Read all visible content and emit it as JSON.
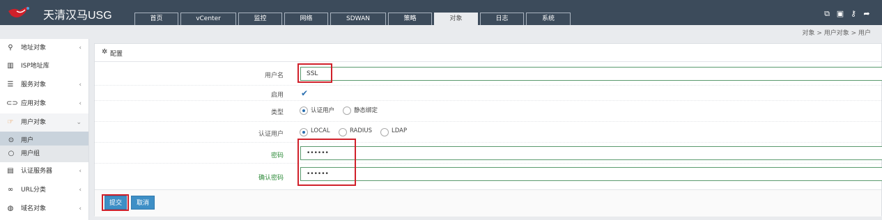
{
  "app": {
    "title": "天清汉马USG",
    "logo_icon": "bird-logo-icon"
  },
  "nav": {
    "tabs": [
      "首页",
      "vCenter",
      "监控",
      "网络",
      "SDWAN",
      "策略",
      "对象",
      "日志",
      "系统"
    ],
    "active": "对象"
  },
  "toolbar": {
    "icons": [
      "compare-icon",
      "save-icon",
      "key-icon",
      "logout-icon"
    ]
  },
  "breadcrumb": {
    "text": "对象 > 用户对象 > 用户"
  },
  "sidebar": {
    "items": [
      {
        "label": "地址对象",
        "icon": "map-marker-icon"
      },
      {
        "label": "ISP地址库",
        "icon": "map-icon"
      },
      {
        "label": "服务对象",
        "icon": "list-icon"
      },
      {
        "label": "应用对象",
        "icon": "toggle-icon"
      },
      {
        "label": "用户对象",
        "icon": "hand-pointer-icon"
      },
      {
        "label": "用户",
        "icon": "radio-dot-icon"
      },
      {
        "label": "用户组",
        "icon": "circle-icon"
      },
      {
        "label": "认证服务器",
        "icon": "server-icon"
      },
      {
        "label": "URL分类",
        "icon": "link-icon"
      },
      {
        "label": "域名对象",
        "icon": "globe-icon"
      }
    ],
    "selected": "用户"
  },
  "panel": {
    "title": "配置",
    "username_label": "用户名",
    "username_value": "SSL",
    "enabled_label": "启用",
    "type_label": "类型",
    "type_options": [
      "认证用户",
      "静态绑定"
    ],
    "type_selected": "认证用户",
    "auth_label": "认证用户",
    "auth_options": [
      "LOCAL",
      "RADIUS",
      "LDAP"
    ],
    "auth_selected": "LOCAL",
    "password_label": "密码",
    "password_value": "••••••",
    "confirm_label": "确认密码",
    "confirm_value": "••••••",
    "submit_label": "提交",
    "cancel_label": "取消"
  },
  "colors": {
    "topbar": "#3c4b5b",
    "accent": "#3e8fc6",
    "highlight": "#d0202a",
    "field_border": "#5a9a6e"
  }
}
